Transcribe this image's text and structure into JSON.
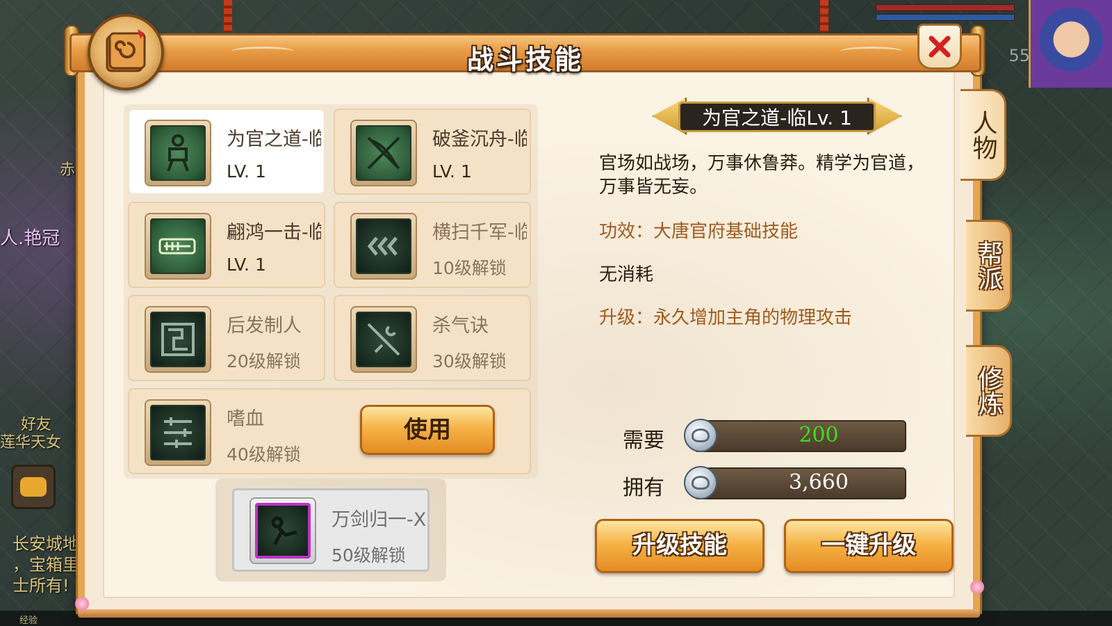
{
  "window": {
    "title": "战斗技能"
  },
  "background": {
    "chat_lines": [
      "长安城地",
      "，宝箱里",
      "士所有!"
    ],
    "side_text": "人.艳冠",
    "side_text2": "好友",
    "side_text3": "莲华天女",
    "side_text4": "赤",
    "level": "55",
    "exp_label": "经验"
  },
  "skills": [
    {
      "name": "为官之道-临",
      "sub": "LV. 1",
      "state": "unlocked",
      "selected": true,
      "icon": "standing-figure-icon"
    },
    {
      "name": "破釜沉舟-临",
      "sub": "LV. 1",
      "state": "unlocked",
      "selected": false,
      "icon": "crossed-blades-icon"
    },
    {
      "name": "翩鸿一击-临",
      "sub": "LV. 1",
      "state": "unlocked",
      "selected": false,
      "icon": "scroll-weapon-icon"
    },
    {
      "name": "横扫千军-临",
      "sub": "10级解锁",
      "state": "locked",
      "selected": false,
      "icon": "triple-chevron-icon"
    },
    {
      "name": "后发制人",
      "sub": "20级解锁",
      "state": "locked",
      "selected": false,
      "icon": "spiral-rune-icon"
    },
    {
      "name": "杀气诀",
      "sub": "30级解锁",
      "state": "locked",
      "selected": false,
      "icon": "slash-blade-icon"
    },
    {
      "name": "嗜血",
      "sub": "40级解锁",
      "state": "locked",
      "selected": false,
      "icon": "rune-bars-icon"
    },
    {
      "name": "万剑归一-Ⅹ",
      "sub": "50级解锁",
      "state": "locked",
      "selected": false,
      "icon": "kick-figure-icon"
    }
  ],
  "use_button": "使用",
  "detail": {
    "header": "为官之道-临Lv. 1",
    "description": "官场如战场，万事休鲁莽。精学为官道，万事皆无妄。",
    "effect": "功效：大唐官府基础技能",
    "cost": "无消耗",
    "upgrade": "升级：永久增加主角的物理攻击"
  },
  "resources": {
    "need_label": "需要",
    "need_value": "200",
    "have_label": "拥有",
    "have_value": "3,660"
  },
  "buttons": {
    "upgrade": "升级技能",
    "one_key": "一键升级"
  },
  "tabs": [
    {
      "label": "人物",
      "active": true
    },
    {
      "label": "帮派",
      "active": false
    },
    {
      "label": "修炼",
      "active": false
    }
  ],
  "colors": {
    "need_value": "#3ae01a",
    "panel_border": "#e4a650",
    "effect_text": "#a05a1e"
  }
}
